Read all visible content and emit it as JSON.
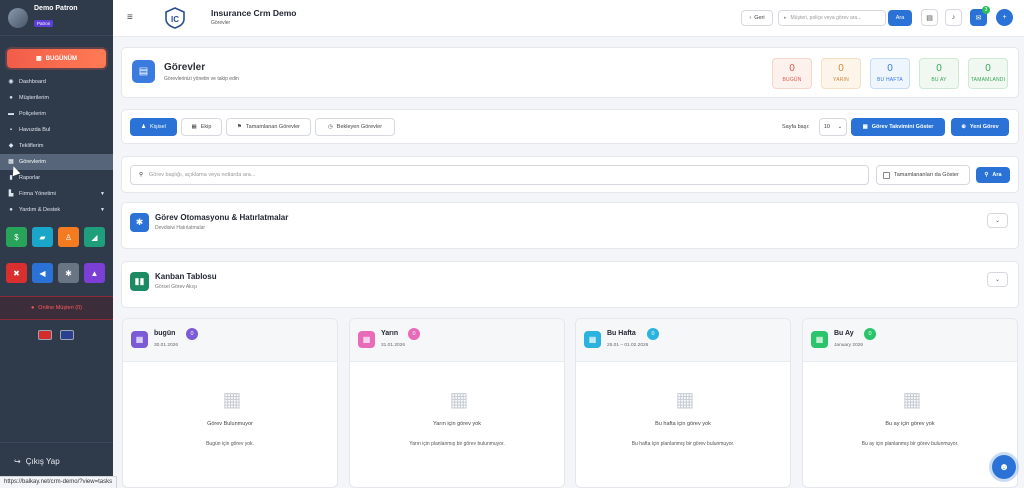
{
  "sidebar": {
    "user_name": "Demo Patron",
    "user_role": "Patron",
    "today_label": "BUGÜNÜM",
    "items": [
      {
        "label": "Dashboard",
        "icon": "dashboard-icon"
      },
      {
        "label": "Müşterilerim",
        "icon": "users-icon"
      },
      {
        "label": "Poliçelerim",
        "icon": "folder-icon"
      },
      {
        "label": "Havuzda Bul",
        "icon": "pool-icon"
      },
      {
        "label": "Tekliflerim",
        "icon": "tag-icon"
      },
      {
        "label": "Görevlerim",
        "icon": "calendar-icon"
      },
      {
        "label": "Raporlar",
        "icon": "chart-icon"
      },
      {
        "label": "Firma Yönetimi",
        "icon": "building-icon"
      },
      {
        "label": "Yardım & Destek",
        "icon": "help-icon"
      }
    ],
    "tiles_row1": [
      {
        "icon": "money-icon",
        "color": "#27a35a"
      },
      {
        "icon": "chat-icon",
        "color": "#19a6c8"
      },
      {
        "icon": "person-icon",
        "color": "#f47b20"
      },
      {
        "icon": "chart-line-icon",
        "color": "#1e9e7a"
      }
    ],
    "tiles_row2": [
      {
        "icon": "close-circle-icon",
        "color": "#d92f2f"
      },
      {
        "icon": "megaphone-icon",
        "color": "#2a72d6"
      },
      {
        "icon": "gear-icon",
        "color": "#6a7583"
      },
      {
        "icon": "graduation-icon",
        "color": "#7b3fd6"
      }
    ],
    "online_label": "Online Müşteri (0)",
    "logout_label": "Çıkış Yap"
  },
  "topbar": {
    "app_title": "Insurance Crm Demo",
    "app_subtitle": "Görevler",
    "back_label": "Geri",
    "search_placeholder": "Müşteri, poliçe veya görev ara...",
    "search_button": "Ara",
    "notification_count": "3"
  },
  "header": {
    "title": "Görevler",
    "subtitle": "Görevlerinizi yönetin ve takip edin",
    "stats": [
      {
        "value": "0",
        "label": "BUGÜN",
        "color": "#f7d4cc",
        "bg": "#fdf1ee",
        "text": "#d9594a"
      },
      {
        "value": "0",
        "label": "YARIN",
        "color": "#f5dfc2",
        "bg": "#fdf5ea",
        "text": "#c98a3a"
      },
      {
        "value": "0",
        "label": "BU HAFTA",
        "color": "#c7dcf5",
        "bg": "#eef5fd",
        "text": "#3a7be0"
      },
      {
        "value": "0",
        "label": "BU AY",
        "color": "#cfe9d4",
        "bg": "#f0f8f1",
        "text": "#3aa55a"
      },
      {
        "value": "0",
        "label": "TAMAMLANDI",
        "color": "#cfe9d4",
        "bg": "#f0f8f1",
        "text": "#3aa55a"
      }
    ]
  },
  "filters": {
    "tabs": [
      "Kişisel",
      "Ekip",
      "Tamamlanan Görevler",
      "Bekleyen Görevler"
    ],
    "page_size_label": "Sayfa başı:",
    "page_size_value": "10",
    "calendar_button": "Görev Takvimini Göster",
    "new_task_button": "Yeni Görev"
  },
  "search": {
    "placeholder": "Görev başlığı, açıklama veya notlarda ara...",
    "show_completed_label": "Tamamlananları da Göster",
    "button": "Ara"
  },
  "automation": {
    "title": "Görev Otomasyonu & Hatırlatmalar",
    "subtitle": "Devdisiw Hatırlatmalar"
  },
  "kanban": {
    "title": "Kanban Tablosu",
    "subtitle": "Görsel Görev Akışı"
  },
  "columns": [
    {
      "title": "bugün",
      "count": "0",
      "date": "30.01.2026",
      "empty_title": "Görev Bulunmuyor",
      "empty_sub": "Bugün için görev yok.",
      "color": "#7b5bd6"
    },
    {
      "title": "Yarın",
      "count": "0",
      "date": "31.01.2026",
      "empty_title": "Yarın için görev yok",
      "empty_sub": "Yarın için planlanmış bir görev bulunmuyor.",
      "color": "#e86ab8"
    },
    {
      "title": "Bu Hafta",
      "count": "0",
      "date": "25.01 – 01.02.2026",
      "empty_title": "Bu hafta için görev yok",
      "empty_sub": "Bu hafta için planlanmış bir görev bulunmuyor.",
      "color": "#2bb3e0"
    },
    {
      "title": "Bu Ay",
      "count": "0",
      "date": "January 2026",
      "empty_title": "Bu ay için görev yok",
      "empty_sub": "Bu ay için planlanmış bir görev bulunmuyor.",
      "color": "#2bc46a"
    }
  ],
  "status_url": "https://balkay.net/crm-demo/?view=tasks"
}
